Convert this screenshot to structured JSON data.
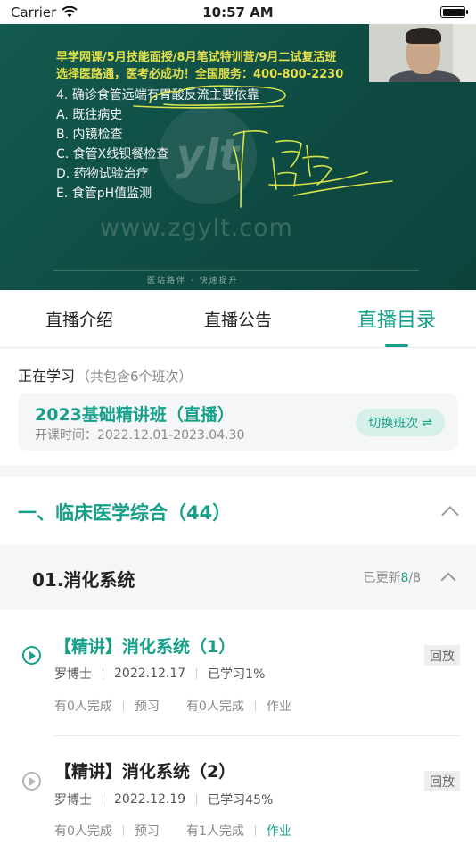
{
  "status_bar": {
    "carrier": "Carrier",
    "time": "10:57 AM",
    "battery_level": 1.0
  },
  "video": {
    "banner_line1": "早学网课/5月技能面授/8月笔试特训营/9月二试复活班",
    "banner_line2": "选择医路通，医考必成功！全国服务：400-800-2230",
    "question": "4. 确诊食管远端有胃酸反流主要依靠",
    "options": [
      "A. 既往病史",
      "B. 内镜检查",
      "C. 食管X线钡餐检查",
      "D. 药物试验治疗",
      "E. 食管pH值监测"
    ],
    "watermark_url": "www.zgylt.com",
    "watermark_logo": "ylt",
    "board_footer": "医站路伴 · 快速提升"
  },
  "tabs": [
    {
      "label": "直播介绍",
      "active": false
    },
    {
      "label": "直播公告",
      "active": false
    },
    {
      "label": "直播目录",
      "active": true
    }
  ],
  "studying": {
    "label": "正在学习",
    "sub": "（共包含6个班次）",
    "class_name": "2023基础精讲班（直播）",
    "class_date": "开课时间：2022.12.01-2023.04.30",
    "switch_label": "切换班次",
    "switch_icon": "⇌"
  },
  "chapter": {
    "title": "一、临床医学综合（44）"
  },
  "section": {
    "title": "01.消化系统",
    "progress_prefix": "已更新",
    "progress_done": "8",
    "progress_total": "/8"
  },
  "lessons": [
    {
      "title": "【精讲】消化系统（1）",
      "teacher": "罗博士",
      "date": "2022.12.17",
      "studied": "已学习1%",
      "preview_done": "有0人完成",
      "preview": "预习",
      "homework_done": "有0人完成",
      "homework": "作业",
      "badge": "回放"
    },
    {
      "title": "【精讲】消化系统（2）",
      "teacher": "罗博士",
      "date": "2022.12.19",
      "studied": "已学习45%",
      "preview_done": "有0人完成",
      "preview": "预习",
      "homework_done": "有1人完成",
      "homework": "作业",
      "badge": "回放"
    }
  ],
  "colors": {
    "accent": "#16a08a",
    "board": "#0f4d45",
    "banner": "#e6e04a"
  }
}
